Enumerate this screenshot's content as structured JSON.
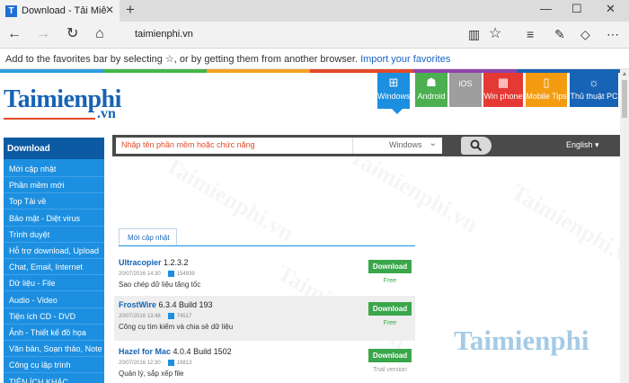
{
  "browser": {
    "tab_title": "Download - Tải Miễn Ph",
    "tab_favicon": "T",
    "url": "taimienphi.vn",
    "favorites_hint": "Add to the favorites bar by selecting ☆, or by getting them from another browser.",
    "import_link": "Import your favorites"
  },
  "site": {
    "logo_main": "Taimienphi",
    "logo_suffix": ".vn",
    "color_strip": [
      "#2d9ee0",
      "#44b549",
      "#f2a223",
      "#e34a2a",
      "#8e44ad",
      "#1763b5"
    ],
    "categories": [
      {
        "label": "Windows",
        "icon": "windows-icon",
        "glyph": "⊞",
        "color": "#1c8fe0",
        "active": true
      },
      {
        "label": "Android",
        "icon": "android-icon",
        "glyph": "☗",
        "color": "#4caf50",
        "active": false
      },
      {
        "label": "iOS",
        "icon": "apple-icon",
        "glyph": "",
        "color": "#9e9e9e",
        "active": false
      },
      {
        "label": "Win phone",
        "icon": "winphone-icon",
        "glyph": "▦",
        "color": "#e53935",
        "active": false
      },
      {
        "label": "Mobile Tips",
        "icon": "mobile-icon",
        "glyph": "▯",
        "color": "#f39c12",
        "active": false
      },
      {
        "label": "Thủ thuật PC",
        "icon": "bulb-icon",
        "glyph": "☼",
        "color": "#1763b5",
        "active": false
      }
    ],
    "search": {
      "placeholder": "Nhập tên phần mềm hoặc chức năng",
      "platform": "Windows"
    },
    "language": "English",
    "sidebar": {
      "header": "Download",
      "items": [
        "Mới cập nhật",
        "Phần mềm mới",
        "Top Tải về",
        "Bảo mật - Diệt virus",
        "Trình duyệt",
        "Hỗ trợ download, Upload",
        "Chat, Email, Internet",
        "Dữ liệu - File",
        "Audio - Video",
        "Tiện ích CD - DVD",
        "Ảnh - Thiết kế đồ họa",
        "Văn bản, Soạn thảo, Note",
        "Công cụ lập trình",
        "TIỆN ÍCH KHÁC"
      ]
    },
    "content_tab": "Mới cập nhật",
    "rows": [
      {
        "name": "Ultracopier",
        "version": "1.2.3.2",
        "date": "20/07/2016 14:30",
        "downloads": "154939",
        "desc": "Sao chép dữ liệu tăng tốc",
        "button": "Download",
        "license": "Free"
      },
      {
        "name": "FrostWire",
        "version": "6.3.4 Build 193",
        "date": "20/07/2016 13:48",
        "downloads": "74517",
        "desc": "Công cụ tìm kiếm và chia sẻ dữ liệu",
        "button": "Download",
        "license": "Free"
      },
      {
        "name": "Hazel for Mac",
        "version": "4.0.4 Build 1502",
        "date": "20/07/2016 12:30",
        "downloads": "19813",
        "desc": "Quản lý, sắp xếp file",
        "button": "Download",
        "license": "Trial version"
      }
    ]
  }
}
